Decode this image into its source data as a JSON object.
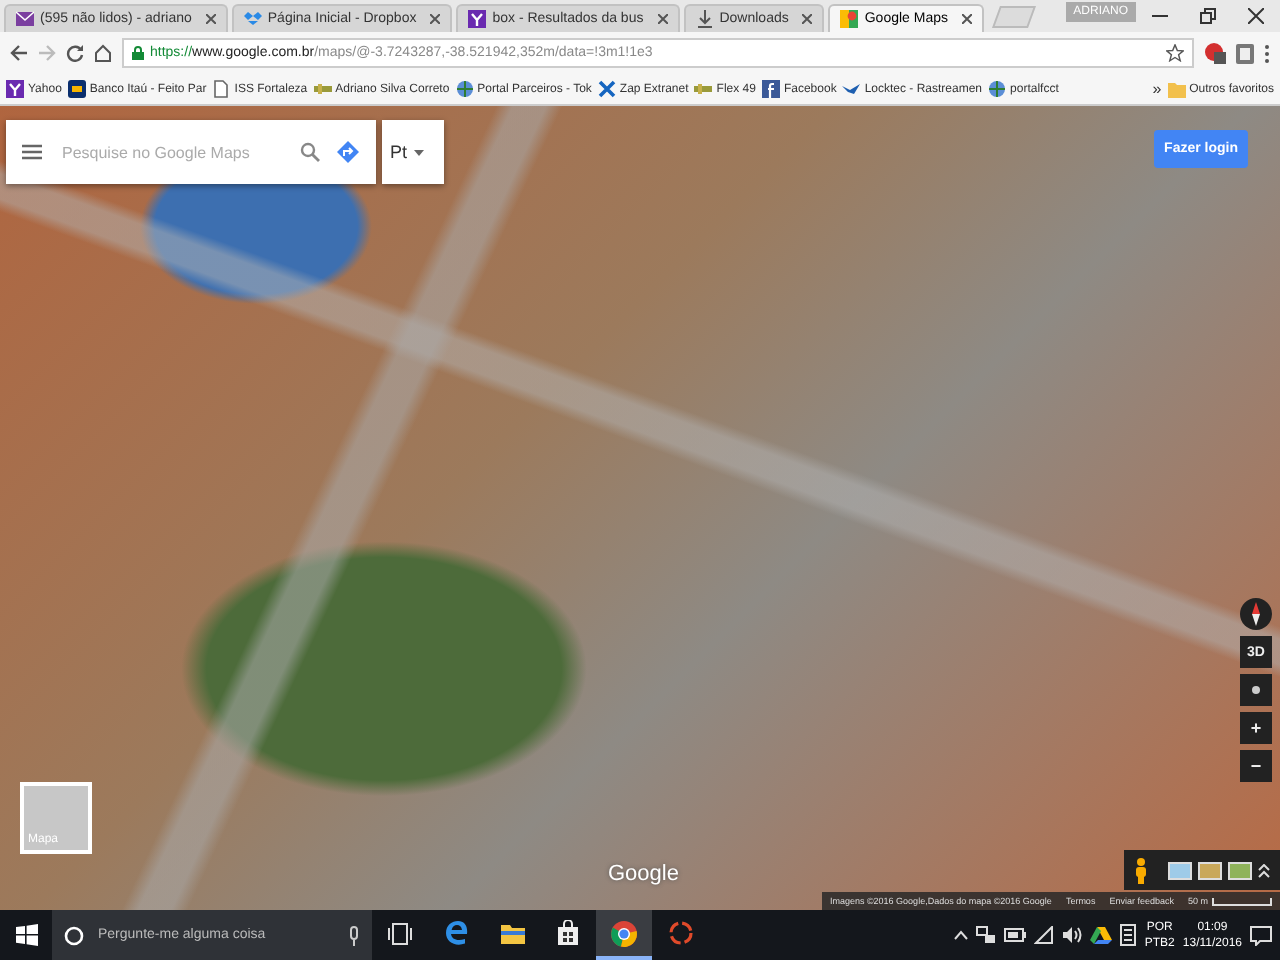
{
  "tabs": [
    {
      "kind": "mail",
      "title": "(595 não lidos) - adriano",
      "selected": false
    },
    {
      "kind": "dropbox",
      "title": "Página Inicial - Dropbox",
      "selected": false
    },
    {
      "kind": "yahoo",
      "title": "box - Resultados da bus",
      "selected": false
    },
    {
      "kind": "download",
      "title": "Downloads",
      "selected": false
    },
    {
      "kind": "maps",
      "title": "Google Maps",
      "selected": true
    }
  ],
  "user": "ADRIANO",
  "address": {
    "scheme": "https://",
    "host": "www.google.com.br",
    "path": "/maps/@-3.7243287,-38.521942,352m/data=!3m1!1e3"
  },
  "bookmarks": [
    {
      "kind": "yahoo",
      "label": "Yahoo"
    },
    {
      "kind": "bank",
      "label": "Banco Itaú - Feito Par"
    },
    {
      "kind": "page",
      "label": "ISS Fortaleza"
    },
    {
      "kind": "site",
      "label": "Adriano Silva Correto"
    },
    {
      "kind": "globe",
      "label": "Portal Parceiros - Tok"
    },
    {
      "kind": "x",
      "label": "Zap Extranet"
    },
    {
      "kind": "site",
      "label": "Flex 49"
    },
    {
      "kind": "facebook",
      "label": "Facebook"
    },
    {
      "kind": "bird",
      "label": "Locktec - Rastreamen"
    },
    {
      "kind": "globe",
      "label": "portalfcct"
    }
  ],
  "bookmarks_more": "»",
  "other_bookmarks": "Outros favoritos",
  "map": {
    "search": {
      "placeholder": "Pesquise no Google Maps"
    },
    "language": "Pt",
    "login": "Fazer login",
    "layer_label": "Mapa",
    "logo": "Google",
    "tilt": "3D",
    "zoom_in": "+",
    "zoom_out": "−",
    "attribution": [
      "Imagens ©2016 Google,Dados do mapa ©2016 Google",
      "Termos",
      "Enviar feedback"
    ],
    "scale": "50 m"
  },
  "taskbar": {
    "search": {
      "placeholder": "Pergunte-me alguma coisa"
    },
    "apps": [
      {
        "kind": "task_view",
        "selected": false
      },
      {
        "kind": "edge",
        "selected": false
      },
      {
        "kind": "explorer",
        "selected": false
      },
      {
        "kind": "store",
        "selected": false
      },
      {
        "kind": "chrome",
        "selected": true
      },
      {
        "kind": "recorder",
        "selected": false
      }
    ],
    "language": [
      "POR",
      "PTB2"
    ],
    "time": "01:09",
    "date": "13/11/2016"
  }
}
